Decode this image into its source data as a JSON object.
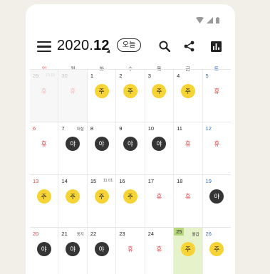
{
  "header": {
    "year_label": "2020.",
    "month_label": "12",
    "today_button": "오늘",
    "icons": [
      "menu-icon",
      "search-icon",
      "share-icon",
      "chart-icon"
    ]
  },
  "weekdays": [
    "일",
    "월",
    "화",
    "수",
    "목",
    "금",
    "토"
  ],
  "colors": {
    "sunday": "#d8474b",
    "saturday": "#2e6fd1",
    "day_shift": "#f7d436",
    "night_shift": "#353535",
    "today_highlight": "#e6f2c9"
  },
  "weeks": [
    [
      {
        "day": "29",
        "note": "10.15",
        "kind": "rest",
        "label": "휴",
        "out": true
      },
      {
        "day": "30",
        "note": "",
        "kind": "rest",
        "label": "휴",
        "out": true
      },
      {
        "day": "1",
        "note": "",
        "kind": "day",
        "label": "주"
      },
      {
        "day": "2",
        "note": "",
        "kind": "day",
        "label": "주"
      },
      {
        "day": "3",
        "note": "",
        "kind": "day",
        "label": "주"
      },
      {
        "day": "4",
        "note": "",
        "kind": "day",
        "label": "주"
      },
      {
        "day": "5",
        "note": "",
        "kind": "rest",
        "label": "휴"
      }
    ],
    [
      {
        "day": "6",
        "note": "",
        "kind": "rest",
        "label": "휴"
      },
      {
        "day": "7",
        "note": "대설",
        "kind": "night",
        "label": "야"
      },
      {
        "day": "8",
        "note": "",
        "kind": "night",
        "label": "야"
      },
      {
        "day": "9",
        "note": "",
        "kind": "night",
        "label": "야"
      },
      {
        "day": "10",
        "note": "",
        "kind": "night",
        "label": "야"
      },
      {
        "day": "11",
        "note": "",
        "kind": "rest",
        "label": "휴"
      },
      {
        "day": "12",
        "note": "",
        "kind": "rest",
        "label": "휴"
      }
    ],
    [
      {
        "day": "13",
        "note": "",
        "kind": "day",
        "label": "주"
      },
      {
        "day": "14",
        "note": "",
        "kind": "day",
        "label": "주"
      },
      {
        "day": "15",
        "note": "11.01",
        "kind": "day",
        "label": "주"
      },
      {
        "day": "16",
        "note": "",
        "kind": "day",
        "label": "주"
      },
      {
        "day": "17",
        "note": "",
        "kind": "rest",
        "label": "휴"
      },
      {
        "day": "18",
        "note": "",
        "kind": "rest",
        "label": "휴"
      },
      {
        "day": "19",
        "note": "",
        "kind": "night",
        "label": "야"
      }
    ],
    [
      {
        "day": "20",
        "note": "",
        "kind": "night",
        "label": "야"
      },
      {
        "day": "21",
        "note": "동지",
        "kind": "night",
        "label": "야"
      },
      {
        "day": "22",
        "note": "",
        "kind": "night",
        "label": "야"
      },
      {
        "day": "23",
        "note": "",
        "kind": "rest",
        "label": "휴"
      },
      {
        "day": "24",
        "note": "",
        "kind": "rest",
        "label": "휴"
      },
      {
        "day": "25",
        "note": "월급",
        "kind": "day",
        "label": "주",
        "highlight": true
      },
      {
        "day": "26",
        "note": "",
        "kind": "day",
        "label": "주"
      }
    ]
  ]
}
